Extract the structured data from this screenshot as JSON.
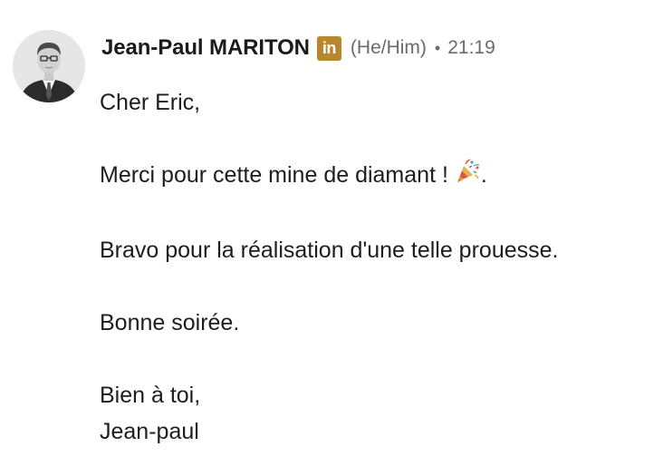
{
  "sender": {
    "name": "Jean-Paul MARITON",
    "badge_text": "in",
    "pronouns": "(He/Him)",
    "separator": "•",
    "time": "21:19"
  },
  "message": {
    "greeting": "Cher Eric,",
    "line1_text": "Merci pour cette mine de diamant !",
    "line1_emoji": "party-popper-emoji",
    "line1_suffix": ".",
    "line2": "Bravo pour la réalisation d'une telle prouesse.",
    "line3": "Bonne soirée.",
    "closing": "Bien à toi,",
    "signature": "Jean-paul"
  },
  "colors": {
    "badge": "#b8862d",
    "meta_text": "#6b6b6b",
    "body_text": "#1d1d1d"
  }
}
